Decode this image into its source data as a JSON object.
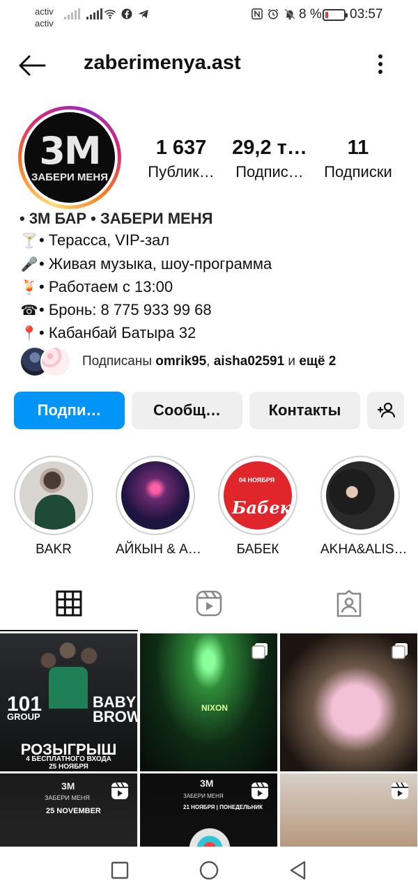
{
  "status_bar": {
    "carrier_1": "activ",
    "carrier_2": "activ",
    "battery_percent": "8 %",
    "time": "03:57",
    "icons": [
      "signal-icon",
      "signal-icon",
      "wifi-icon",
      "facebook-icon",
      "telegram-icon",
      "nfc-icon",
      "alarm-icon",
      "mute-icon",
      "battery-icon"
    ]
  },
  "header": {
    "username": "zaberimenya.ast",
    "back_icon": "arrow-left-icon",
    "more_icon": "more-vertical-icon"
  },
  "profile": {
    "avatar_logo": "3M",
    "avatar_sub": "ЗАБЕРИ МЕНЯ",
    "stats": [
      {
        "value": "1 637",
        "label": "Публик…"
      },
      {
        "value": "29,2 т…",
        "label": "Подпис…"
      },
      {
        "value": "11",
        "label": "Подписки"
      }
    ],
    "bio_name": "• 3М БАР • ЗАБЕРИ МЕНЯ",
    "bio_lines": [
      {
        "emoji": "🍸",
        "text": "• Терасса, VIP-зал"
      },
      {
        "emoji": "🎤",
        "text": "• Живая музыка, шоу-программа"
      },
      {
        "emoji": "🍹",
        "text": "• Работаем с 13:00"
      },
      {
        "emoji": "☎",
        "text": "• Бронь: 8 775 933 99 68"
      },
      {
        "emoji": "📍",
        "text": "• Кабанбай Батыра 32"
      }
    ],
    "followed_by_prefix": "Подписаны ",
    "followed_by_user_1": "omrik95",
    "followed_by_sep": ", ",
    "followed_by_user_2": "aisha02591",
    "followed_by_and": " и ",
    "followed_by_more": "ещё 2"
  },
  "actions": {
    "follow": "Подпи…",
    "message": "Сообщ…",
    "contacts": "Контакты",
    "suggest_icon": "add-person-icon"
  },
  "highlights": [
    {
      "label": "BAKR"
    },
    {
      "label": "АЙКЫН & А…"
    },
    {
      "label": "БАБЕК",
      "cover_date": "04 НОЯБРЯ",
      "cover_title": "Бабек"
    },
    {
      "label": "AKHA&ALIS…"
    }
  ],
  "tabs": [
    {
      "name": "posts",
      "icon": "grid-icon",
      "active": true
    },
    {
      "name": "reels",
      "icon": "reels-icon",
      "active": false
    },
    {
      "name": "tagged",
      "icon": "tagged-icon",
      "active": false
    }
  ],
  "posts": [
    {
      "type": "image",
      "text_1": "101",
      "text_1b": "GROUP",
      "text_2a": "BABY",
      "text_2b": "BROWN",
      "text_3": "РОЗЫГРЫШ",
      "text_4a": "4 БЕСПЛАТНОГО ВХОДА",
      "text_4b": "25 НОЯБРЯ"
    },
    {
      "type": "carousel",
      "sign": "NIXON"
    },
    {
      "type": "carousel"
    },
    {
      "type": "reel",
      "logo": "3M",
      "sub": "ЗАБЕРИ МЕНЯ",
      "date": "25 NOVEMBER"
    },
    {
      "type": "reel",
      "logo": "3M",
      "sub": "ЗАБЕРИ МЕНЯ",
      "date": "21 НОЯБРЯ | ПОНЕДЕЛЬНИК"
    },
    {
      "type": "reel"
    }
  ],
  "colors": {
    "accent": "#0095f6",
    "button_bg": "#efefef",
    "text": "#111111"
  }
}
